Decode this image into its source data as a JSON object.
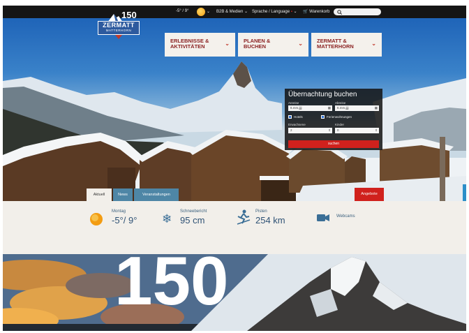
{
  "logo": {
    "number": "150",
    "name": "ZERMATT",
    "tagline": "MATTERHORN"
  },
  "topbar": {
    "temperature": "-5° / 9°",
    "b2b_label": "B2B & Medien",
    "language_label": "Sprache / Language",
    "cart_label": "Warenkorb",
    "search_placeholder": ""
  },
  "nav": [
    {
      "line1": "ERLEBNISSE &",
      "line2": "AKTIVITÄTEN"
    },
    {
      "line1": "PLANEN &",
      "line2": "BUCHEN"
    },
    {
      "line1": "ZERMATT &",
      "line2": "MATTERHORN"
    }
  ],
  "booking": {
    "title": "Übernachtung buchen",
    "arrival_label": "Anreise",
    "arrival_value": "tt.mm.jjjj",
    "departure_label": "Abreise",
    "departure_value": "tt.mm.jjjj",
    "hotels_label": "Hotels",
    "apartments_label": "Ferienwohnungen",
    "adults_label": "Erwachsene",
    "adults_value": "2",
    "children_label": "Kinder",
    "children_value": "0",
    "search_button": "suchen"
  },
  "tabs": [
    "Aktuell",
    "News",
    "Veranstaltungen"
  ],
  "offers_button": "Angebote",
  "weather": {
    "day_label": "Montag",
    "temp_value": "-5°/ 9°",
    "snow_label": "Schneebericht",
    "snow_value": "95 cm",
    "pistes_label": "Pisten",
    "pistes_value": "254 km",
    "webcams_label": "Webcams"
  },
  "banner_number": "150",
  "colors": {
    "brand_red": "#d0211d",
    "brand_blue": "#2d5a9e",
    "nav_text": "#8a1f1f",
    "strip_bg": "#f2efea"
  }
}
